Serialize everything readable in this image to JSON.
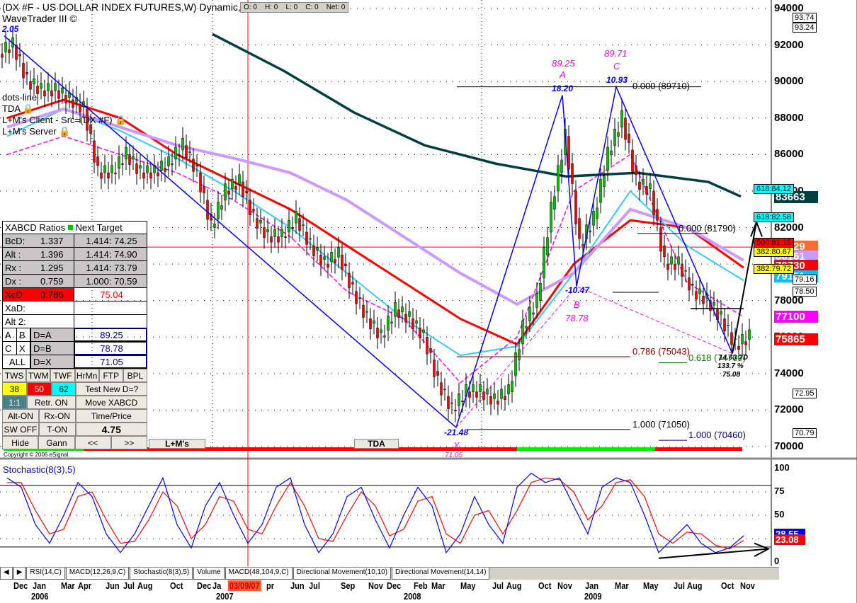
{
  "header": {
    "title": "(DX #F - US DOLLAR INDEX FUTURES,W) Dynamic,0:0",
    "subtitle": "WaveTrader III ©",
    "ohlc": "O: 0    H: 0    L: 0    C: 0    Net: 0",
    "start_label": "2.05"
  },
  "studies": {
    "dots": "dots-line",
    "tda": "TDA",
    "client": "L+M's Client - Src=(DX #F)",
    "server": "L+M's Server"
  },
  "colors": {
    "up": "#00c000",
    "down": "#ff0000",
    "ma_red": "#ff0000",
    "ma_cyan": "#33ccff",
    "ma_violet": "#cc99ff",
    "ma_magenta": "#ff00ff",
    "ma_green": "#004040",
    "pattern": "#0000ff"
  },
  "chart_data": {
    "type": "candlestick",
    "price_range": [
      69500,
      94000
    ],
    "yticks": [
      94000,
      92000,
      90000,
      88000,
      86000,
      84000,
      82000,
      80000,
      78000,
      76000,
      74000,
      72000,
      70000
    ],
    "closes": [
      92,
      90,
      89.5,
      89.5,
      89,
      88.5,
      85,
      85,
      86,
      85,
      85,
      85.5,
      86.5,
      85,
      82,
      84,
      84.5,
      82.5,
      81.5,
      81.5,
      82.5,
      81,
      80,
      80.5,
      78.5,
      77,
      76,
      77.5,
      77,
      76,
      73.5,
      72,
      73,
      73,
      72.5,
      73,
      76.5,
      78,
      83,
      87,
      81,
      82.5,
      86,
      88,
      84.5,
      84,
      80,
      80,
      78.5,
      78,
      77,
      75.5,
      76
    ],
    "ma": [
      {
        "name": "red",
        "values": [
          [
            0,
            88
          ],
          [
            4,
            89
          ],
          [
            8,
            88
          ],
          [
            12,
            86
          ],
          [
            16,
            84.5
          ],
          [
            20,
            83
          ],
          [
            24,
            81
          ],
          [
            28,
            79
          ],
          [
            32,
            77
          ],
          [
            36,
            75.6
          ],
          [
            40,
            80
          ],
          [
            44,
            82.4
          ],
          [
            48,
            82
          ],
          [
            52,
            79.8
          ]
        ]
      },
      {
        "name": "cyan",
        "values": [
          [
            0,
            87
          ],
          [
            4,
            88.5
          ],
          [
            8,
            87.3
          ],
          [
            12,
            85.8
          ],
          [
            16,
            84
          ],
          [
            20,
            82
          ],
          [
            24,
            79.5
          ],
          [
            28,
            77
          ],
          [
            32,
            75
          ],
          [
            36,
            75.5
          ],
          [
            40,
            79.5
          ],
          [
            44,
            84
          ],
          [
            48,
            81
          ],
          [
            52,
            79.1
          ]
        ]
      },
      {
        "name": "violet",
        "values": [
          [
            0,
            87.5
          ],
          [
            4,
            88.5
          ],
          [
            8,
            87.5
          ],
          [
            12,
            86.5
          ],
          [
            16,
            85.8
          ],
          [
            20,
            85
          ],
          [
            24,
            83.5
          ],
          [
            28,
            81.5
          ],
          [
            32,
            79.5
          ],
          [
            36,
            77.8
          ],
          [
            40,
            79.5
          ],
          [
            44,
            83
          ],
          [
            48,
            82
          ],
          [
            52,
            80.2
          ]
        ]
      },
      {
        "name": "magenta",
        "values": [
          [
            0,
            86
          ],
          [
            4,
            87
          ],
          [
            8,
            86
          ],
          [
            12,
            85
          ],
          [
            16,
            83.5
          ],
          [
            20,
            81.5
          ],
          [
            24,
            78.5
          ],
          [
            28,
            77
          ],
          [
            32,
            73.5
          ],
          [
            36,
            76
          ],
          [
            40,
            84
          ],
          [
            44,
            86
          ],
          [
            48,
            79
          ],
          [
            52,
            77.1
          ]
        ]
      },
      {
        "name": "green",
        "values": [
          [
            14.5,
            92.6
          ],
          [
            19.5,
            90.6
          ],
          [
            24.5,
            88.3
          ],
          [
            29.5,
            86.5
          ],
          [
            34.5,
            85.5
          ],
          [
            39.5,
            84.8
          ],
          [
            44.5,
            85
          ],
          [
            49.5,
            84.5
          ],
          [
            51.8,
            83.7
          ]
        ]
      }
    ],
    "pattern": {
      "points": [
        [
          "start",
          -0.2,
          92.5
        ],
        [
          "X",
          31.7,
          71.05
        ],
        [
          "A",
          39.2,
          89.25
        ],
        [
          "B",
          40.2,
          78.78
        ],
        [
          "C",
          43,
          89.71
        ],
        [
          "D",
          51.2,
          75.1
        ]
      ],
      "labels": {
        "X": "X",
        "A": "A",
        "B": "B",
        "C": "C",
        "A_price": "89.25",
        "C_price": "89.71",
        "B_price": "78.78",
        "X_price": "71.05",
        "A_bars": "18.20",
        "C_bars": "10.93",
        "B_bars": "-10.47",
        "X_bars": "-21.48",
        "D_info": [
          "14.63 ?D",
          "133.7 %",
          "75.08"
        ]
      }
    },
    "levels": [
      {
        "label": "0.000 (89710)",
        "price": 89.71,
        "color": "#000"
      },
      {
        "label": "0.000 (81790)",
        "price": 81.79,
        "color": "#000"
      },
      {
        "label": "0.786 (75043)",
        "price": 75.043,
        "color": "#800000"
      },
      {
        "label": "0.618 (74709)",
        "price": 74.709,
        "color": "#008000"
      },
      {
        "label": "1.000 (71050)",
        "price": 71.05,
        "color": "#000"
      },
      {
        "label": "1.000 (70460)",
        "price": 70.46,
        "color": "#000080"
      }
    ],
    "current_line": 80929,
    "cursor_date": "03/09/07",
    "stochastic": {
      "title": "Stochastic(8(3),5)",
      "yticks": [
        "100",
        "75",
        "50",
        "25",
        "0"
      ],
      "k": [
        90,
        80,
        40,
        20,
        50,
        85,
        70,
        30,
        10,
        30,
        60,
        90,
        40,
        15,
        60,
        85,
        50,
        20,
        40,
        80,
        90,
        40,
        10,
        30,
        70,
        80,
        45,
        15,
        50,
        80,
        60,
        10,
        30,
        70,
        40,
        20,
        80,
        95,
        85,
        90,
        60,
        30,
        80,
        90,
        85,
        50,
        10,
        25,
        40,
        20,
        10,
        15,
        28
      ],
      "d": [
        85,
        85,
        55,
        30,
        35,
        70,
        75,
        45,
        20,
        22,
        45,
        75,
        60,
        25,
        40,
        70,
        65,
        35,
        30,
        60,
        85,
        60,
        25,
        22,
        50,
        75,
        60,
        28,
        35,
        65,
        70,
        30,
        20,
        50,
        55,
        30,
        55,
        85,
        90,
        88,
        75,
        45,
        60,
        85,
        88,
        70,
        30,
        20,
        32,
        30,
        18,
        14,
        23
      ],
      "k_last": "28.55",
      "d_last": "23.08"
    }
  },
  "axis": {
    "right_labels": [
      "94000",
      "92000",
      "90000",
      "88000",
      "86000",
      "84000",
      "82000",
      "80000",
      "78000",
      "76000",
      "74000",
      "72000",
      "70000"
    ],
    "badges": [
      {
        "v": "83663",
        "bg": "#004040",
        "p": 83663
      },
      {
        "v": "80929",
        "bg": "#ff6a33",
        "p": 80929
      },
      {
        "v": "80161",
        "bg": "#cc99ff",
        "p": 80400
      },
      {
        "v": "79730",
        "bg": "#ff0000",
        "p": 79900
      },
      {
        "v": "79151",
        "bg": "#00c0ff",
        "p": 79300
      },
      {
        "v": "77100",
        "bg": "#ff00ff",
        "p": 77100
      },
      {
        "v": "75865",
        "bg": "#ff0000",
        "p": 75865
      }
    ]
  },
  "boxes": [
    {
      "v": "93.74",
      "p": 93.5
    },
    {
      "v": "93.24",
      "p": 92.95
    },
    {
      "v": "79.16",
      "p": 79.15
    },
    {
      "v": "78.50",
      "p": 78.5
    },
    {
      "v": "72.95",
      "p": 72.9
    },
    {
      "v": "70.79",
      "p": 70.75
    }
  ],
  "targets": [
    {
      "v": "618:84.12",
      "bg": "#00ffff",
      "p": 84.12
    },
    {
      "v": "618:82.58",
      "bg": "#00ffff",
      "p": 82.58
    },
    {
      "v": "500:81.15",
      "bg": "#ff0000",
      "p": 81.15
    },
    {
      "v": "382:80.67",
      "bg": "#ffff00",
      "p": 80.67
    },
    {
      "v": "382:79.72",
      "bg": "#ffff00",
      "p": 79.72
    }
  ],
  "panel": {
    "title": "XABCD Ratios",
    "next": "Next Target",
    "rows": [
      {
        "k": "BcD:",
        "r": "1.337",
        "t": "1.414: 74.25"
      },
      {
        "k": "Alt  :",
        "r": "1.396",
        "t": "1.414: 74.90"
      },
      {
        "k": "Rx  :",
        "r": "1.295",
        "t": "1.414: 73.79"
      },
      {
        "k": "Dx  :",
        "r": "0.759",
        "t": "1.000: 70.59"
      }
    ],
    "xcd": {
      "k": "XcD:",
      "r": "0.786",
      "t": "75.04"
    },
    "xad": "XaD:",
    "alt2": "Alt 2:",
    "d_rows": [
      {
        "a": "A",
        "b": "B",
        "k": "D=A",
        "v": "89.25"
      },
      {
        "a": "C",
        "b": "X",
        "k": "D=B",
        "v": "78.78"
      },
      {
        "a": "ALL",
        "k": "D=X",
        "v": "71.05"
      }
    ],
    "btn1": [
      "TWS",
      "TWM",
      "TWF",
      "HrMn",
      "FTP",
      "BPL"
    ],
    "tws": "38",
    "twm": "50",
    "twf": "62",
    "test": "Test New D=?",
    "r11": "1:1",
    "retr": "Retr. ON",
    "move": "Move XABCD",
    "alt": "Alt-ON",
    "rx": "Rx-ON",
    "tp": "Time/Price",
    "sw": "SW OFF",
    "ton": "T-ON",
    "val": "4.75",
    "hide": "Hide",
    "gann": "Gann",
    "prev": "<<",
    "next_btn": ">>"
  },
  "tabs_chart": {
    "lm": "L+M's",
    "tda": "TDA"
  },
  "copyright": "Copyright © 2006 eSignal.",
  "bottom_tabs": [
    "RSI(14,C)",
    "MACD(12,26,9,C)",
    "Stochastic(8(3),5)",
    "Volume",
    "MACD(48,104,9,C)",
    "Directional Movement(10,10)",
    "Directional Movement(14,14)"
  ],
  "dates": [
    "Dec",
    "Jan",
    "Mar",
    "Apr",
    "Jun",
    "Jul",
    "Aug",
    "Oct",
    "Dec",
    "Ja",
    "pr",
    "Jun",
    "Jul",
    "Sep",
    "Nov",
    "Dec",
    "Feb",
    "Mar",
    "May",
    "Jul",
    "Aug",
    "Oct",
    "Nov",
    "Jan",
    "Mar",
    "May",
    "Jul",
    "Aug",
    "Oct",
    "Nov"
  ],
  "years": [
    "2006",
    "2007",
    "2008",
    "2009"
  ]
}
